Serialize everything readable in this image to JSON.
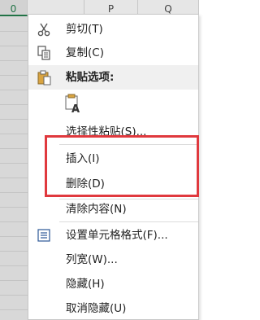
{
  "sheet": {
    "columns": [
      {
        "label": "0"
      },
      {
        "label": "P"
      },
      {
        "label": "Q"
      }
    ]
  },
  "menu": {
    "items": [
      {
        "label": "剪切(T)",
        "icon": "scissors-icon"
      },
      {
        "label": "复制(C)",
        "icon": "copy-icon"
      },
      {
        "label": "粘贴选项:",
        "icon": "clipboard-paste-icon"
      },
      {
        "label": "选择性粘贴(S)..."
      },
      {
        "label": "插入(I)"
      },
      {
        "label": "删除(D)"
      },
      {
        "label": "清除内容(N)"
      },
      {
        "label": "设置单元格格式(F)...",
        "icon": "format-cells-icon"
      },
      {
        "label": "列宽(W)..."
      },
      {
        "label": "隐藏(H)"
      },
      {
        "label": "取消隐藏(U)"
      }
    ],
    "paste_option_icon": "paste-keep-formatting-icon"
  },
  "colors": {
    "highlight": "#e0393e",
    "selected_column": "#d8d8d8",
    "accent": "#217346"
  }
}
